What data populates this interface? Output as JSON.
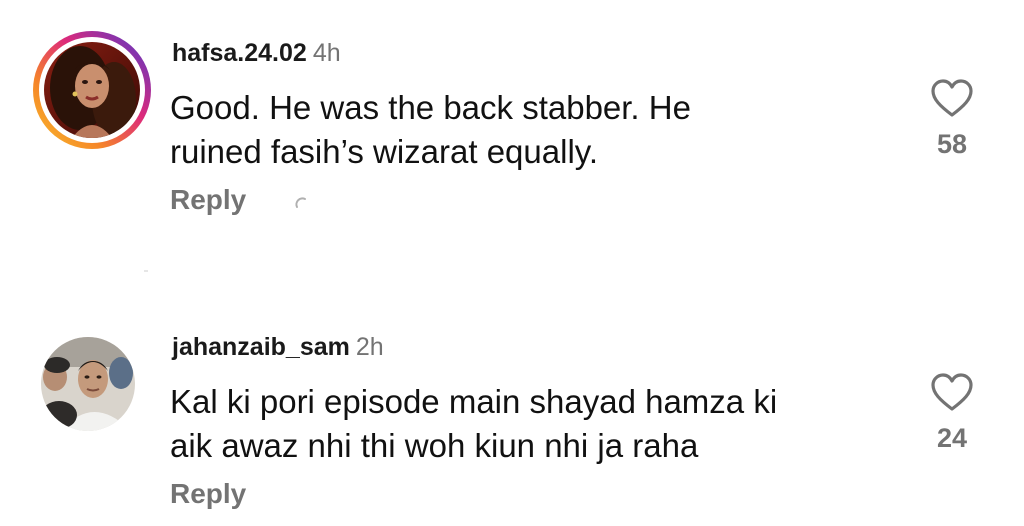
{
  "comments": [
    {
      "username": "hafsa.24.02",
      "timestamp": "4h",
      "text_lines": [
        "Good. He was the back stabber. He",
        "ruined fasih’s wizarat equally."
      ],
      "reply_label": "Reply",
      "like_count": "58",
      "avatar": "woman-portrait",
      "story_ring": true
    },
    {
      "username": "jahanzaib_sam",
      "timestamp": "2h",
      "text_lines": [
        "Kal ki pori episode main shayad hamza ki",
        "aik awaz nhi thi woh kiun nhi ja raha"
      ],
      "reply_label": "Reply",
      "like_count": "24",
      "avatar": "man-portrait",
      "story_ring": false
    }
  ],
  "icons": {
    "like": "heart-outline-icon",
    "loading": "spinner-icon"
  },
  "colors": {
    "username": "#1a1a1a",
    "secondary_text": "#737373",
    "body_text": "#111111",
    "story_ring_gradient": [
      "#f9c02a",
      "#f58529",
      "#dd2a7b",
      "#8134af"
    ]
  }
}
